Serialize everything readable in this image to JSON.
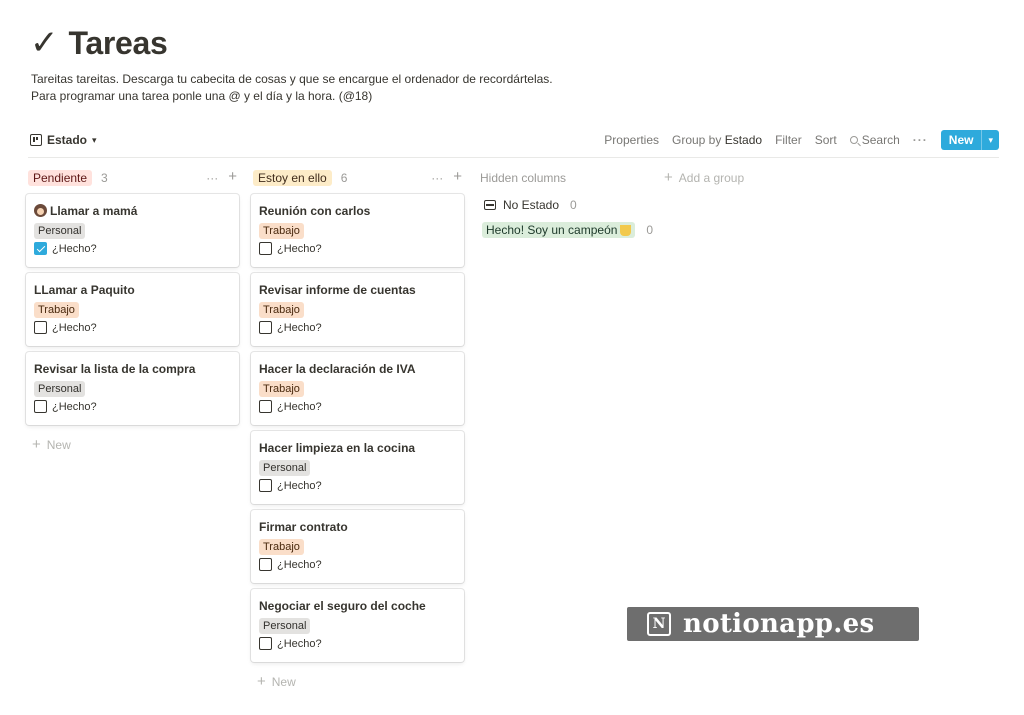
{
  "page": {
    "title_icon": "✓",
    "title": "Tareas",
    "description": [
      "Tareitas tareitas. Descarga tu cabecita de cosas y que se encargue el ordenador de recordártelas.",
      "Para programar una tarea ponle una @ y el día y la hora. (@18)"
    ]
  },
  "toolbar": {
    "view_label": "Estado",
    "properties": "Properties",
    "group_by_prefix": "Group by",
    "group_by_value": "Estado",
    "filter": "Filter",
    "sort": "Sort",
    "search": "Search",
    "more": "···",
    "new": "New"
  },
  "columns": [
    {
      "name": "Pendiente",
      "color": "#ffe2dd",
      "text_color": "#5d1715",
      "count": "3",
      "more": "···",
      "plus": "+",
      "new_label": "New",
      "cards": [
        {
          "title": "Llamar a mamá",
          "icon": "woman-emoji-icon",
          "tag": "Personal",
          "tag_kind": "personal",
          "check_label": "¿Hecho?",
          "checked": true
        },
        {
          "title": "LLamar a Paquito",
          "icon": null,
          "tag": "Trabajo",
          "tag_kind": "trabajo",
          "check_label": "¿Hecho?",
          "checked": false
        },
        {
          "title": "Revisar la lista de la compra",
          "icon": null,
          "tag": "Personal",
          "tag_kind": "personal",
          "check_label": "¿Hecho?",
          "checked": false
        }
      ]
    },
    {
      "name": "Estoy en ello",
      "color": "#fdecc8",
      "text_color": "#402c1b",
      "count": "6",
      "more": "···",
      "plus": "+",
      "new_label": "New",
      "cards": [
        {
          "title": "Reunión con carlos",
          "icon": null,
          "tag": "Trabajo",
          "tag_kind": "trabajo",
          "check_label": "¿Hecho?",
          "checked": false
        },
        {
          "title": "Revisar informe de cuentas",
          "icon": null,
          "tag": "Trabajo",
          "tag_kind": "trabajo",
          "check_label": "¿Hecho?",
          "checked": false
        },
        {
          "title": "Hacer la declaración de IVA",
          "icon": null,
          "tag": "Trabajo",
          "tag_kind": "trabajo",
          "check_label": "¿Hecho?",
          "checked": false
        },
        {
          "title": "Hacer limpieza en la cocina",
          "icon": null,
          "tag": "Personal",
          "tag_kind": "personal",
          "check_label": "¿Hecho?",
          "checked": false
        },
        {
          "title": "Firmar contrato",
          "icon": null,
          "tag": "Trabajo",
          "tag_kind": "trabajo",
          "check_label": "¿Hecho?",
          "checked": false
        },
        {
          "title": "Negociar el seguro del coche",
          "icon": null,
          "tag": "Personal",
          "tag_kind": "personal",
          "check_label": "¿Hecho?",
          "checked": false
        }
      ]
    }
  ],
  "hidden": {
    "title": "Hidden columns",
    "items": [
      {
        "label": "No Estado",
        "count": "0",
        "icon": "inbox-tray-icon"
      },
      {
        "label": "Hecho! Soy un campeón",
        "count": "0",
        "icon": "trophy-icon"
      }
    ]
  },
  "add_group": "Add a group",
  "watermark": {
    "logo_glyph": "N",
    "text": "notionapp.es"
  }
}
